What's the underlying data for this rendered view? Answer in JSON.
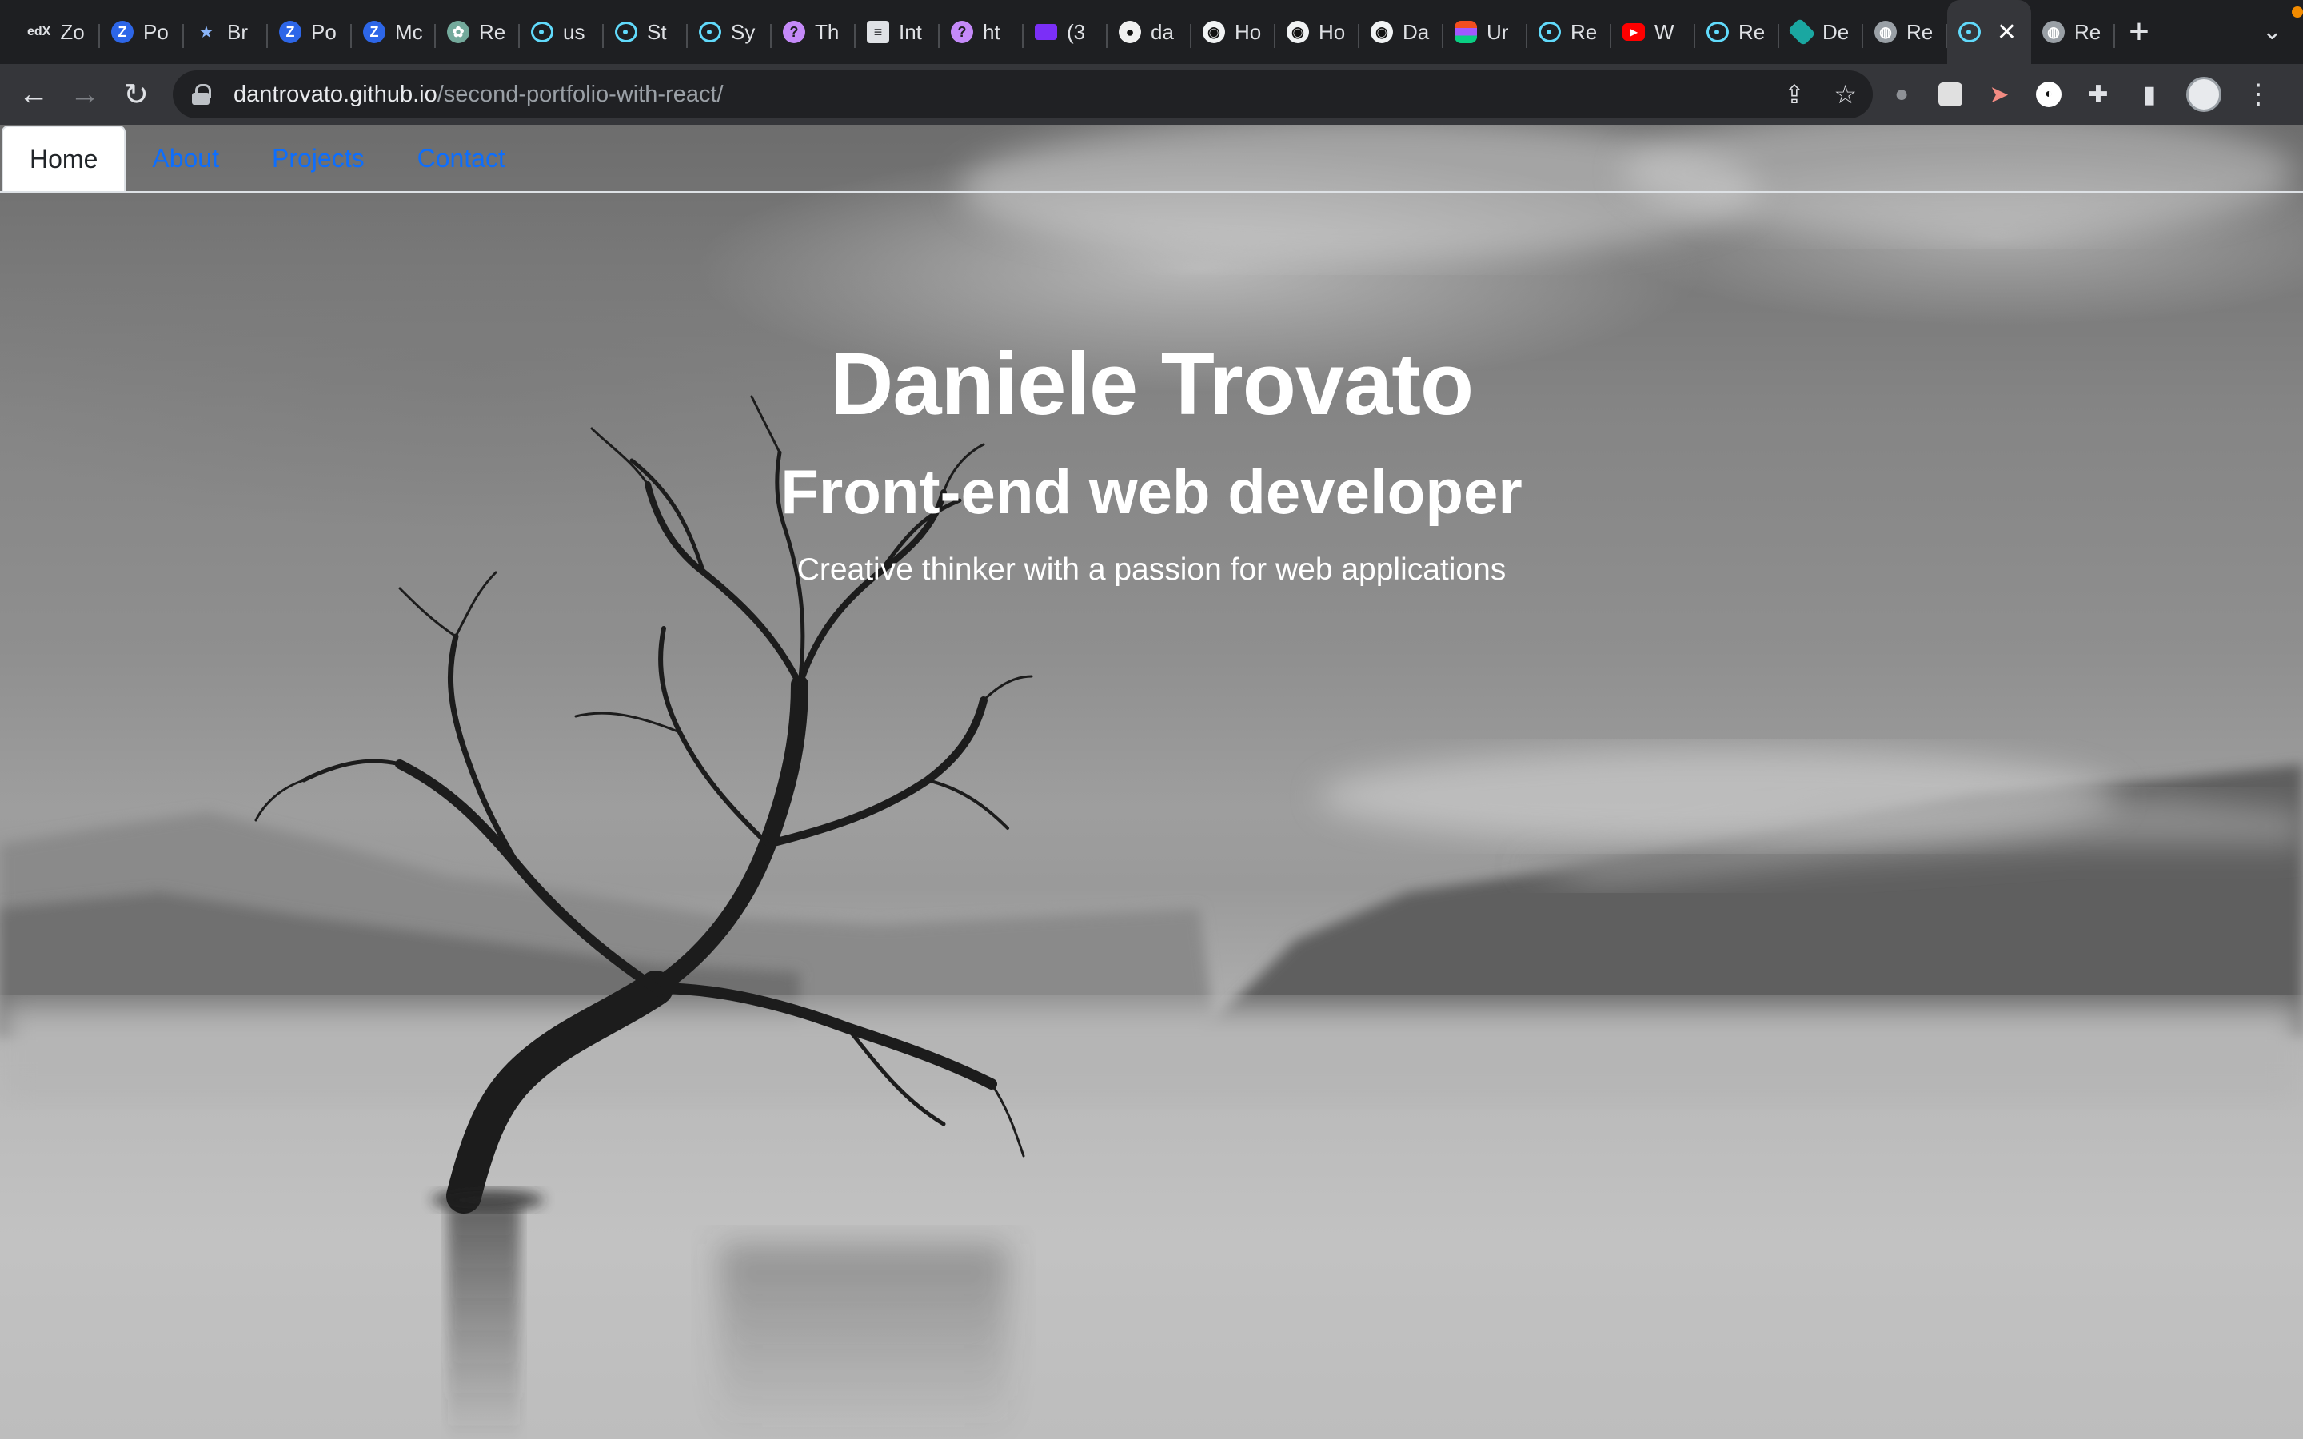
{
  "browser": {
    "tabs": [
      {
        "icon": "edx-icon",
        "glyph": "edX",
        "label": "Zo",
        "cls": "edx"
      },
      {
        "icon": "zoom-icon",
        "glyph": "Z",
        "label": "Po",
        "cls": "zoom"
      },
      {
        "icon": "star-icon",
        "glyph": "★",
        "label": "Br",
        "cls": "star"
      },
      {
        "icon": "zoom-icon",
        "glyph": "Z",
        "label": "Po",
        "cls": "zoom"
      },
      {
        "icon": "zoom-icon",
        "glyph": "Z",
        "label": "Mc",
        "cls": "zoom"
      },
      {
        "icon": "chatgpt-icon",
        "glyph": "✿",
        "label": "Re",
        "cls": "gpt"
      },
      {
        "icon": "react-icon",
        "glyph": "",
        "label": "us",
        "cls": "react"
      },
      {
        "icon": "react-icon",
        "glyph": "",
        "label": "St",
        "cls": "react"
      },
      {
        "icon": "react-icon",
        "glyph": "",
        "label": "Sy",
        "cls": "react"
      },
      {
        "icon": "question-icon",
        "glyph": "?",
        "label": "Th",
        "cls": "q"
      },
      {
        "icon": "document-icon",
        "glyph": "≡",
        "label": "Int",
        "cls": "doc"
      },
      {
        "icon": "question-icon",
        "glyph": "?",
        "label": "ht",
        "cls": "q"
      },
      {
        "icon": "mail-icon",
        "glyph": "",
        "label": "(3",
        "cls": "mail"
      },
      {
        "icon": "github-icon",
        "glyph": "●",
        "label": "da",
        "cls": "github"
      },
      {
        "icon": "shield-icon",
        "glyph": "◉",
        "label": "Ho",
        "cls": "shield"
      },
      {
        "icon": "shield-icon",
        "glyph": "◉",
        "label": "Ho",
        "cls": "shield"
      },
      {
        "icon": "shield-icon",
        "glyph": "◉",
        "label": "Da",
        "cls": "shield"
      },
      {
        "icon": "figma-icon",
        "glyph": "",
        "label": "Ur",
        "cls": "figma"
      },
      {
        "icon": "react-icon",
        "glyph": "",
        "label": "Re",
        "cls": "react"
      },
      {
        "icon": "youtube-icon",
        "glyph": "▶",
        "label": "W",
        "cls": "yt"
      },
      {
        "icon": "react-icon",
        "glyph": "",
        "label": "Re",
        "cls": "react"
      },
      {
        "icon": "diamond-icon",
        "glyph": "",
        "label": "De",
        "cls": "green"
      },
      {
        "icon": "globe-icon",
        "glyph": "◍",
        "label": "Re",
        "cls": "globe"
      },
      {
        "icon": "react-icon",
        "glyph": "",
        "label": "",
        "cls": "react",
        "active": true
      },
      {
        "icon": "globe-icon",
        "glyph": "◍",
        "label": "Re",
        "cls": "globe"
      }
    ],
    "close_glyph": "✕",
    "newtab_glyph": "+",
    "tab_menu_glyph": "⌄",
    "back_glyph": "←",
    "forward_glyph": "→",
    "reload_glyph": "↻",
    "url_host": "dantrovato.github.io",
    "url_path": "/second-portfolio-with-react/",
    "share_glyph": "⇪",
    "bookmark_glyph": "☆",
    "puzzle_glyph": "✚",
    "sidepanel_glyph": "▮",
    "menu_glyph": "⋮"
  },
  "page": {
    "nav": {
      "items": [
        "Home",
        "About",
        "Projects",
        "Contact"
      ],
      "active_index": 0
    },
    "hero": {
      "name": "Daniele Trovato",
      "role": "Front-end web developer",
      "tagline": "Creative thinker with a passion for web applications"
    }
  },
  "colors": {
    "link": "#0d6efd",
    "active_tab_text": "#212529",
    "hero_text": "#ffffff"
  }
}
